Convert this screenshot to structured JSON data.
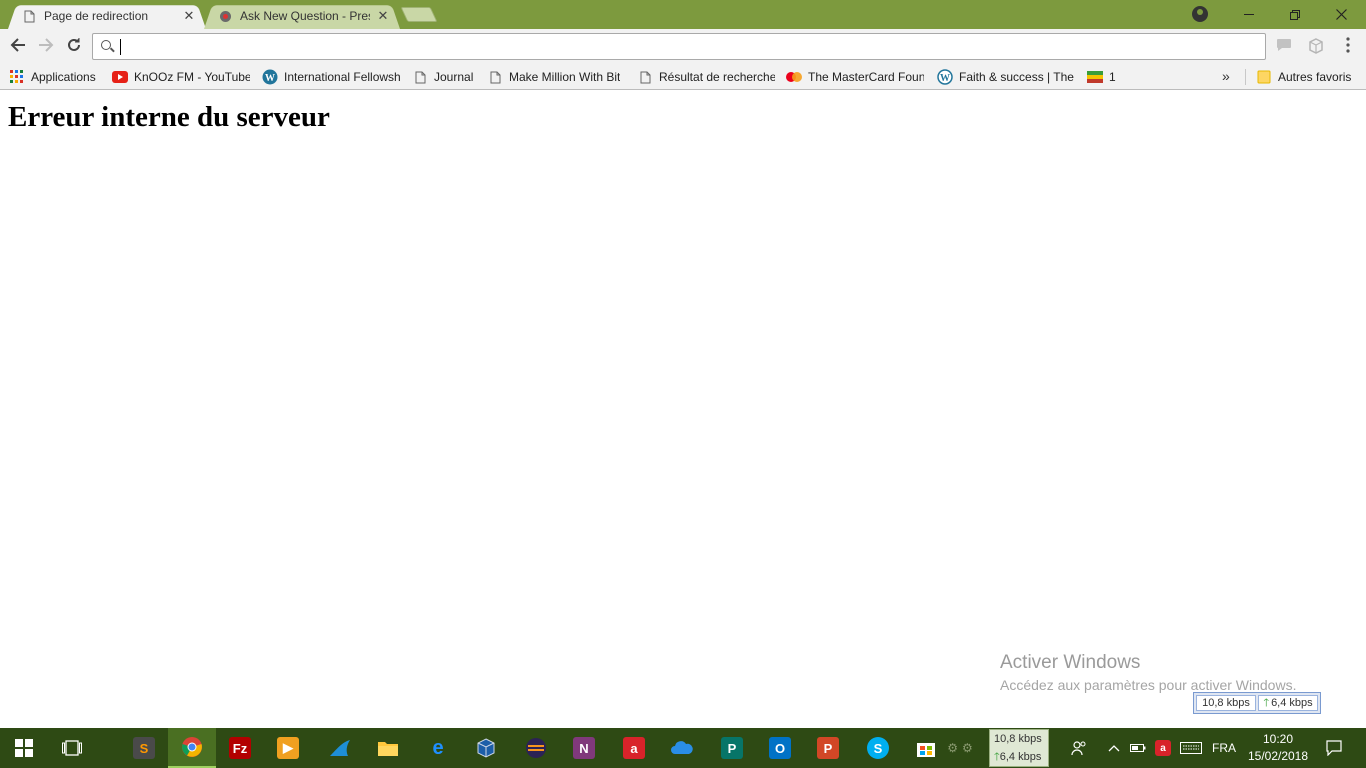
{
  "browser": {
    "tabs": [
      {
        "title": "Page de redirection",
        "active": true,
        "favicon": "document-icon"
      },
      {
        "title": "Ask New Question - Pres",
        "active": false,
        "favicon": "stack-icon"
      }
    ],
    "omnibox": {
      "value": "",
      "placeholder": ""
    }
  },
  "bookmarks": {
    "items": [
      {
        "label": "Applications",
        "icon": "apps-grid-icon"
      },
      {
        "label": "KnOOz FM - YouTube",
        "icon": "youtube-icon"
      },
      {
        "label": "International Fellowsh",
        "icon": "wordpress-icon"
      },
      {
        "label": "Journal",
        "icon": "document-icon"
      },
      {
        "label": "Make Million With Bit",
        "icon": "document-icon"
      },
      {
        "label": "Résultat de recherche",
        "icon": "document-icon"
      },
      {
        "label": "The MasterCard Foun",
        "icon": "mastercard-icon"
      },
      {
        "label": "Faith & success | The",
        "icon": "wordpress-icon"
      },
      {
        "label": "1",
        "icon": "flag-icon"
      }
    ],
    "overflow": "»",
    "other_folder": "Autres favoris"
  },
  "page": {
    "heading": "Erreur interne du serveur"
  },
  "watermark": {
    "title": "Activer Windows",
    "subtitle": "Accédez aux paramètres pour activer Windows."
  },
  "netmon": {
    "down": "10,8 kbps",
    "up": "6,4 kbps"
  },
  "taskbar": {
    "language": "FRA",
    "time": "10:20",
    "date": "15/02/2018"
  },
  "colors": {
    "frame": "#7d9a3e",
    "taskbar": "#2e4a14"
  }
}
